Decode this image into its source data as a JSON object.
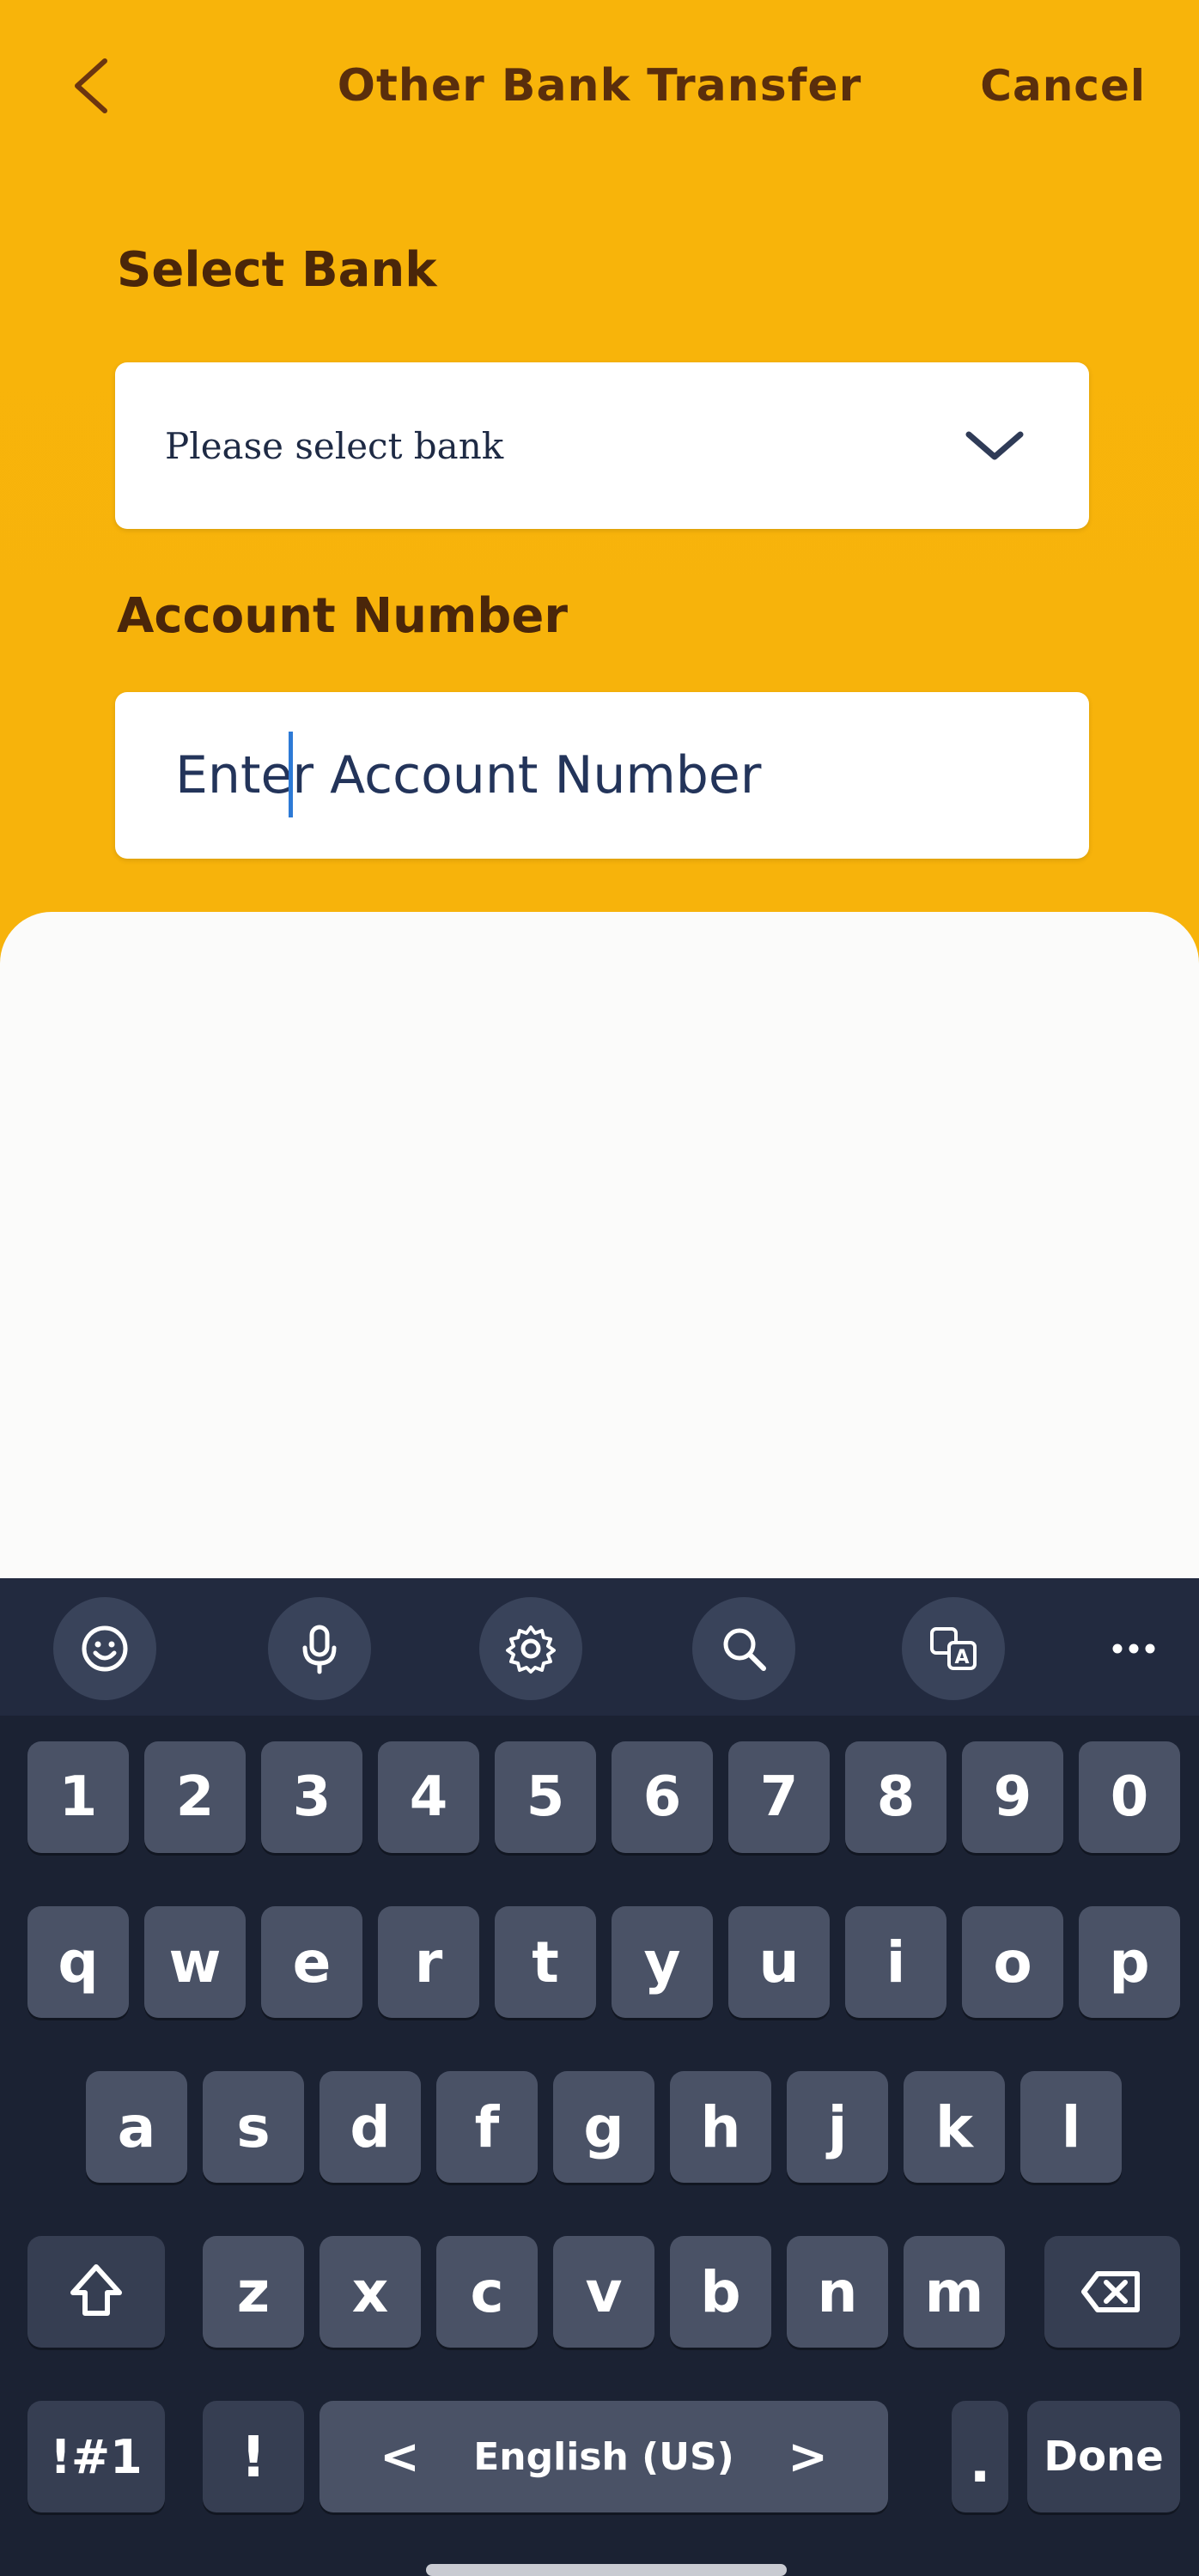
{
  "header": {
    "back_label": "back",
    "title": "Other Bank Transfer",
    "cancel_label": "Cancel"
  },
  "form": {
    "bank_label": "Select Bank",
    "bank_placeholder": "Please select bank",
    "account_label": "Account Number",
    "account_placeholder": "Enter Account Number",
    "account_value": ""
  },
  "keyboard": {
    "toolbar": [
      "emoji-icon",
      "mic-icon",
      "gear-icon",
      "search-icon",
      "translate-icon",
      "more-icon"
    ],
    "number_row": [
      "1",
      "2",
      "3",
      "4",
      "5",
      "6",
      "7",
      "8",
      "9",
      "0"
    ],
    "row1": [
      "q",
      "w",
      "e",
      "r",
      "t",
      "y",
      "u",
      "i",
      "o",
      "p"
    ],
    "row2": [
      "a",
      "s",
      "d",
      "f",
      "g",
      "h",
      "j",
      "k",
      "l"
    ],
    "row3": [
      "z",
      "x",
      "c",
      "v",
      "b",
      "n",
      "m"
    ],
    "symbols_label": "!#1",
    "exclaim_label": "!",
    "language_label": "English (US)",
    "left_arrow": "<",
    "right_arrow": ">",
    "period_label": ".",
    "done_label": "Done"
  },
  "colors": {
    "header_bg": "#f6b20c",
    "keyboard_bg": "#1e2538",
    "key_bg": "#4a5266",
    "text_brown": "#5a2e0c"
  }
}
